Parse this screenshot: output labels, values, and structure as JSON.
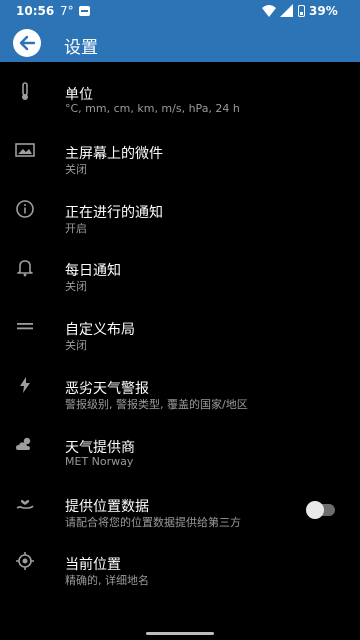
{
  "status_bar": {
    "time": "10:56",
    "temperature": "7°",
    "battery": "39%"
  },
  "app_bar": {
    "title": "设置",
    "back_icon": "arrow-left-icon"
  },
  "settings": [
    {
      "icon": "thermometer-icon",
      "title": "单位",
      "subtitle": "°C, mm, cm, km, m/s, hPa, 24 h"
    },
    {
      "icon": "image-icon",
      "title": "主屏幕上的微件",
      "subtitle": "关闭"
    },
    {
      "icon": "info-icon",
      "title": "正在进行的通知",
      "subtitle": "开启"
    },
    {
      "icon": "bell-icon",
      "title": "每日通知",
      "subtitle": "关闭"
    },
    {
      "icon": "equals-icon",
      "title": "自定义布局",
      "subtitle": "关闭"
    },
    {
      "icon": "lightning-icon",
      "title": "恶劣天气警报",
      "subtitle": "警报级别, 警报类型, 覆盖的国家/地区"
    },
    {
      "icon": "weather-icon",
      "title": "天气提供商",
      "subtitle": "MET Norway"
    },
    {
      "icon": "hand-heart-icon",
      "title": "提供位置数据",
      "subtitle": "请配合将您的位置数据提供给第三方",
      "toggle": false
    },
    {
      "icon": "location-icon",
      "title": "当前位置",
      "subtitle": "精确的, 详细地名"
    }
  ]
}
